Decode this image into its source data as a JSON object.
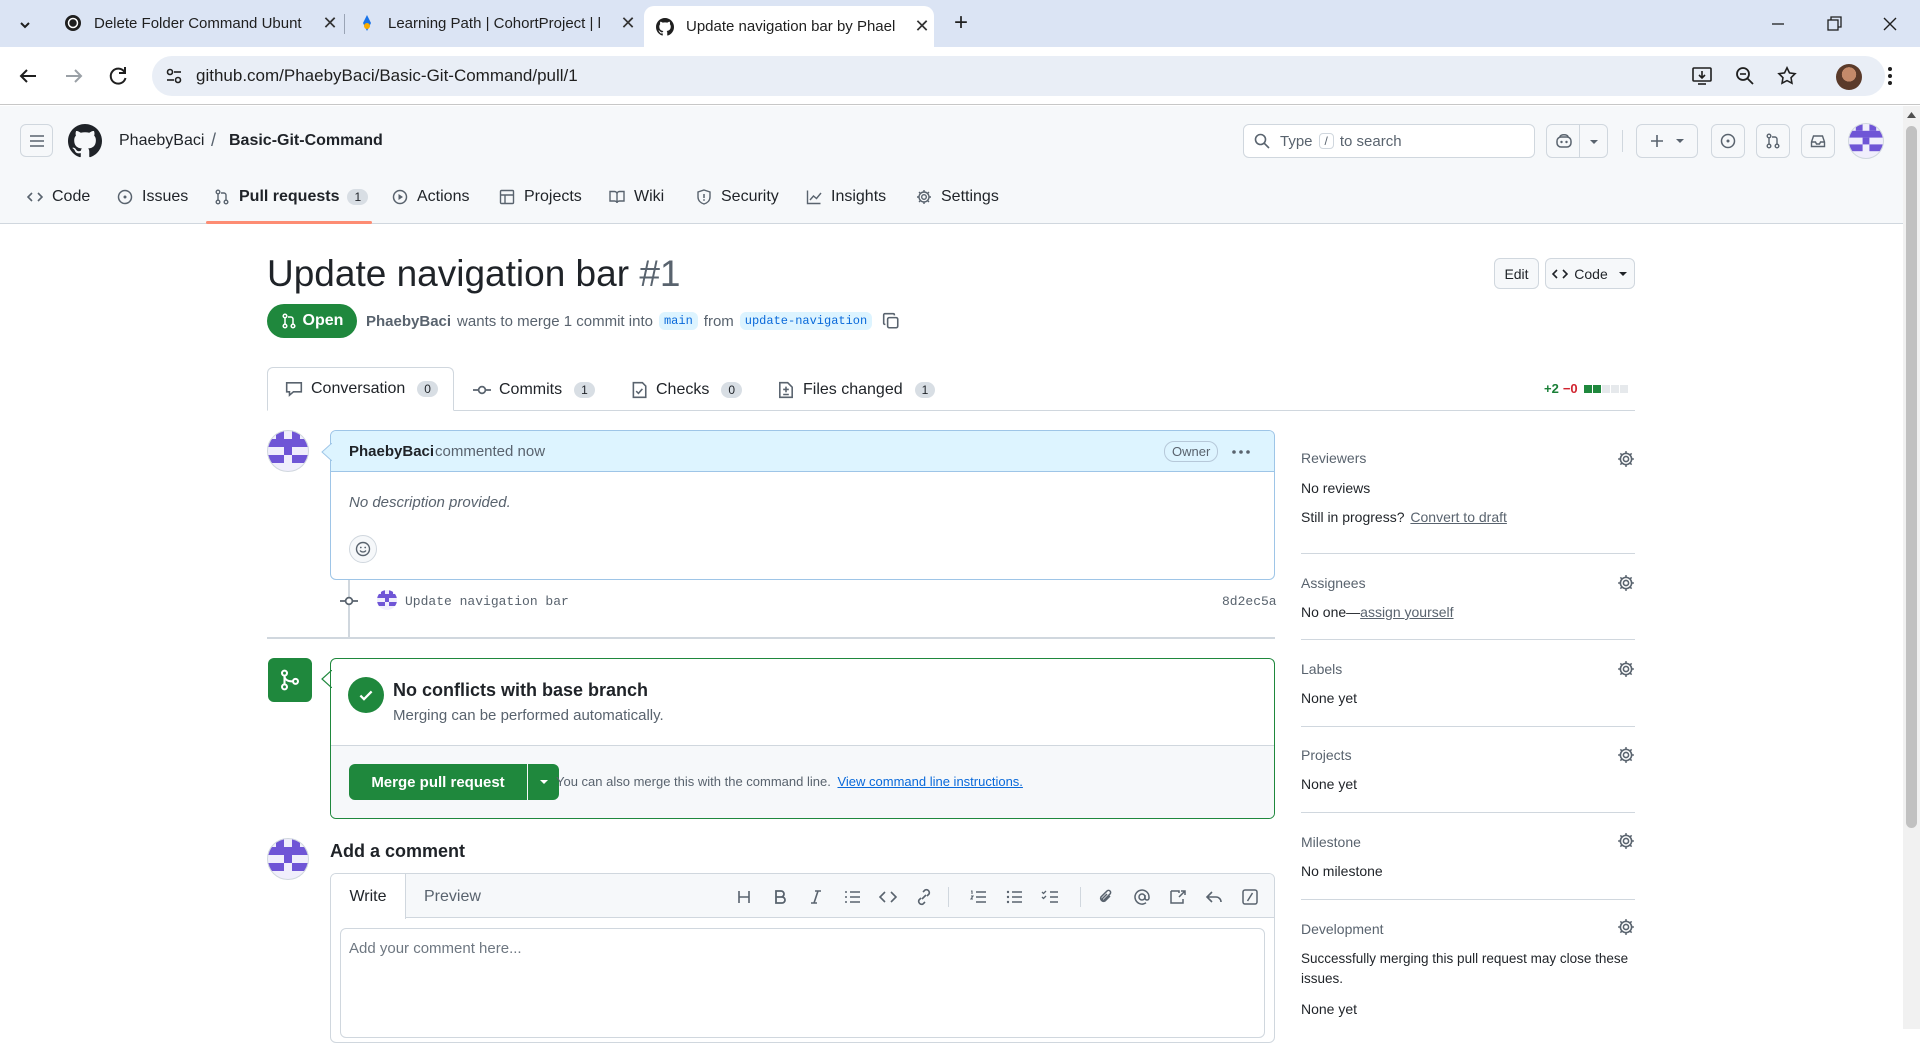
{
  "browser": {
    "tabs": [
      {
        "title": "Delete Folder Command Ubunt",
        "active": false
      },
      {
        "title": "Learning Path | CohortProject | l",
        "active": false
      },
      {
        "title": "Update navigation bar by Phael",
        "active": true
      }
    ],
    "url": "github.com/PhaebyBaci/Basic-Git-Command/pull/1"
  },
  "repo": {
    "owner": "PhaebyBaci",
    "separator": "/",
    "name": "Basic-Git-Command",
    "search_prefix": "Type",
    "search_key": "/",
    "search_suffix": "to search"
  },
  "repo_tabs": [
    {
      "label": "Code",
      "icon": "code-icon"
    },
    {
      "label": "Issues",
      "icon": "issue-icon"
    },
    {
      "label": "Pull requests",
      "icon": "pull-request-icon",
      "count": "1",
      "active": true
    },
    {
      "label": "Actions",
      "icon": "play-icon"
    },
    {
      "label": "Projects",
      "icon": "table-icon"
    },
    {
      "label": "Wiki",
      "icon": "book-icon"
    },
    {
      "label": "Security",
      "icon": "shield-icon"
    },
    {
      "label": "Insights",
      "icon": "graph-icon"
    },
    {
      "label": "Settings",
      "icon": "gear-icon"
    }
  ],
  "pr": {
    "title": "Update navigation bar",
    "number": "#1",
    "edit_label": "Edit",
    "code_label": "Code",
    "state": "Open",
    "author": "PhaebyBaci",
    "merge_text": "wants to merge 1 commit into",
    "base_branch": "main",
    "from_text": "from",
    "head_branch": "update-navigation"
  },
  "pr_tabs": [
    {
      "label": "Conversation",
      "count": "0",
      "icon": "comment-icon",
      "active": true
    },
    {
      "label": "Commits",
      "count": "1",
      "icon": "commit-icon"
    },
    {
      "label": "Checks",
      "count": "0",
      "icon": "checklist-icon"
    },
    {
      "label": "Files changed",
      "count": "1",
      "icon": "file-diff-icon"
    }
  ],
  "diffstat": {
    "additions": "+2",
    "deletions": "−0"
  },
  "comment": {
    "author": "PhaebyBaci",
    "meta": "commented now",
    "badge": "Owner",
    "body": "No description provided."
  },
  "commit": {
    "message": "Update navigation bar",
    "sha": "8d2ec5a"
  },
  "merge_box": {
    "title": "No conflicts with base branch",
    "subtitle": "Merging can be performed automatically.",
    "button": "Merge pull request",
    "hint": "You can also merge this with the command line.",
    "link": "View command line instructions."
  },
  "add_comment": {
    "heading": "Add a comment",
    "tab_write": "Write",
    "tab_preview": "Preview",
    "placeholder": "Add your comment here..."
  },
  "sidebar": {
    "reviewers": {
      "heading": "Reviewers",
      "value": "No reviews",
      "progress_prefix": "Still in progress?",
      "progress_link": "Convert to draft"
    },
    "assignees": {
      "heading": "Assignees",
      "value": "No one—",
      "link": "assign yourself"
    },
    "labels": {
      "heading": "Labels",
      "value": "None yet"
    },
    "projects": {
      "heading": "Projects",
      "value": "None yet"
    },
    "milestone": {
      "heading": "Milestone",
      "value": "No milestone"
    },
    "development": {
      "heading": "Development",
      "value": "Successfully merging this pull request may close these issues.",
      "value2": "None yet"
    }
  },
  "colors": {
    "accent_green": "#1f883d",
    "link_blue": "#0969da",
    "tab_underline": "#fd8c73",
    "avatar_purple": "#6f55d6"
  }
}
